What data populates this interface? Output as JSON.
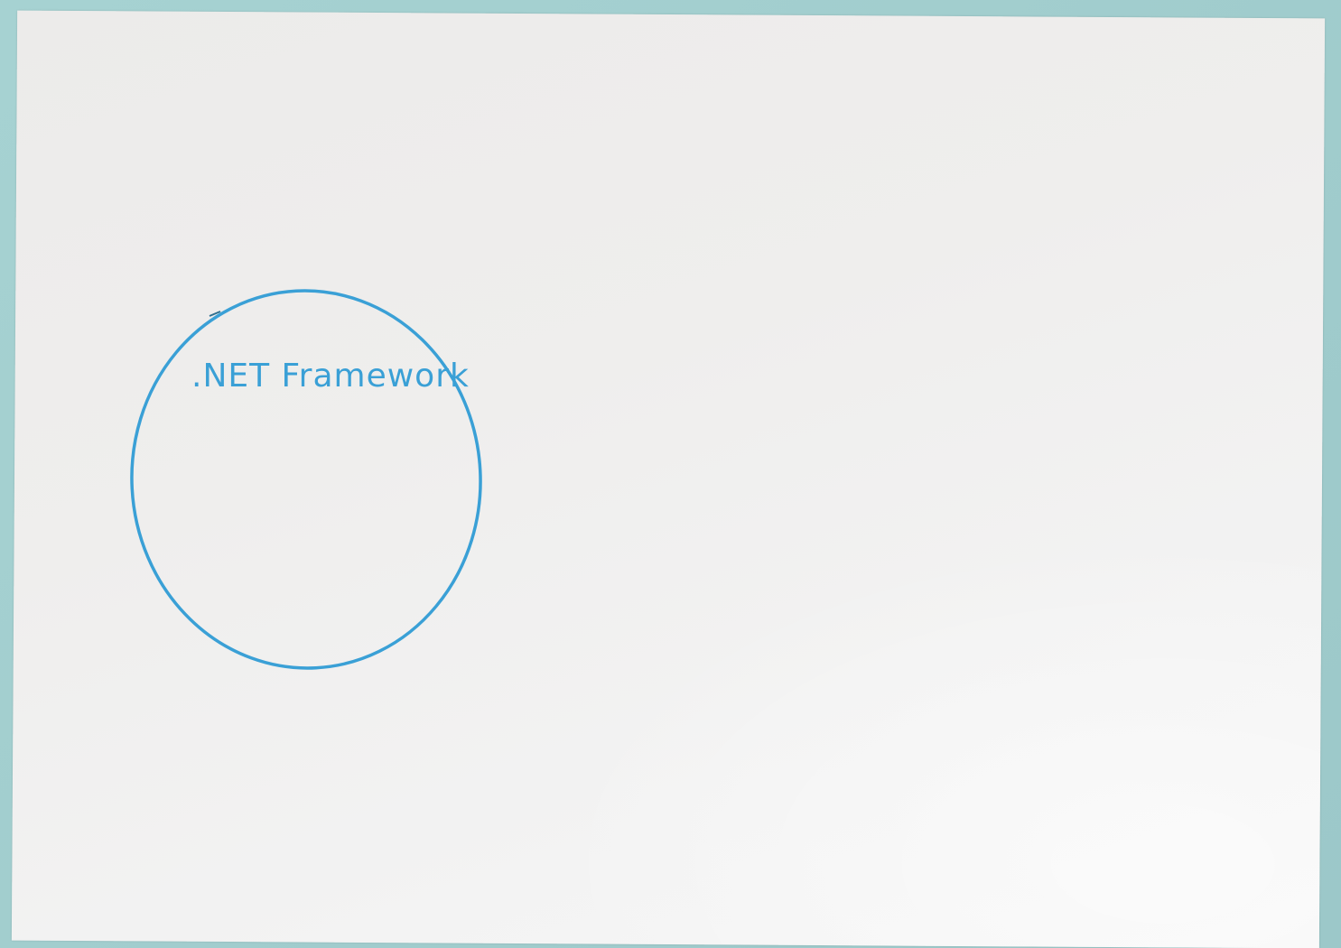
{
  "diagram": {
    "circle_label": ".NET Framework",
    "ink_color": "#3aa0d6",
    "paper_color": "#efeeed",
    "background_color": "#9ecbcb"
  }
}
